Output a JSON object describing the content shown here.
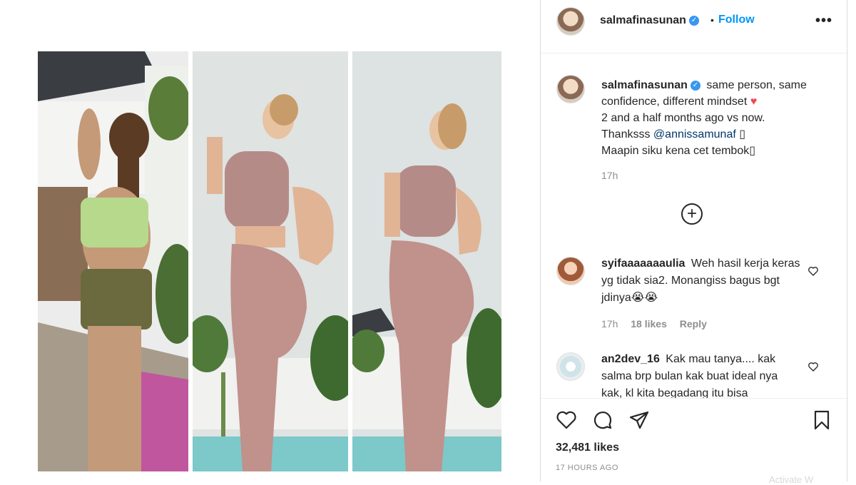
{
  "post": {
    "author": "salmafinasunan",
    "follow_label": "Follow",
    "separator": "•",
    "more_label": "•••"
  },
  "caption": {
    "username": "salmafinasunan",
    "line1": "same person, same confidence, different mindset",
    "heart": "♥",
    "line2": "2 and a half months ago vs now.",
    "line3_prefix": "Thanksss",
    "line3_mention": "@annissamunaf",
    "line3_suffix": "▯",
    "line4": "Maapin siku kena cet tembok▯",
    "time": "17h"
  },
  "load_more_label": "+",
  "comments": [
    {
      "username": "syifaaaaaaaulia",
      "text": "Weh hasil kerja keras yg tidak sia2. Monangiss bagus bgt jdinya😭😭",
      "time": "17h",
      "likes": "18 likes",
      "reply": "Reply"
    },
    {
      "username": "an2dev_16",
      "text": "Kak mau tanya.... kak salma brp bulan kak buat ideal nya kak, kl kita begadang itu bisa"
    }
  ],
  "footer": {
    "likes_count": "32,481 likes",
    "post_time": "17 HOURS AGO",
    "watermark": "Activate W"
  },
  "icons": {
    "like": "heart-outline-icon",
    "comment": "speech-bubble-icon",
    "share": "paper-plane-icon",
    "save": "bookmark-icon",
    "verified": "verified-badge-icon"
  },
  "colors": {
    "accent": "#0095f6",
    "verified": "#3897f0",
    "heart": "#ed4956",
    "muted": "#8e8e8e",
    "border": "#dbdbdb"
  }
}
